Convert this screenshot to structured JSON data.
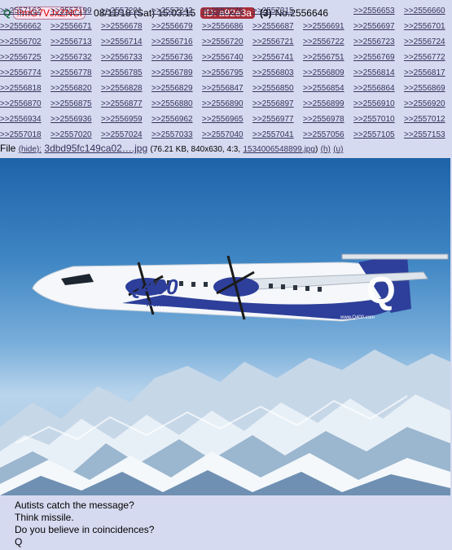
{
  "header": {
    "name": "Q",
    "tripcode": "!!mG7VJxZNCI",
    "datetime": "08/11/18 (Sat) 15:03:15",
    "id": "ID: a92e3a",
    "post_count": "(3)",
    "post_number": "No.2556646"
  },
  "backlinks": [
    ">>2556653",
    ">>2556660",
    ">>2556662",
    ">>2556671",
    ">>2556678",
    ">>2556679",
    ">>2556686",
    ">>2556687",
    ">>2556691",
    ">>2556697",
    ">>2556701",
    ">>2556702",
    ">>2556713",
    ">>2556714",
    ">>2556716",
    ">>2556720",
    ">>2556721",
    ">>2556722",
    ">>2556723",
    ">>2556724",
    ">>2556725",
    ">>2556732",
    ">>2556733",
    ">>2556736",
    ">>2556740",
    ">>2556741",
    ">>2556751",
    ">>2556769",
    ">>2556772",
    ">>2556774",
    ">>2556778",
    ">>2556785",
    ">>2556789",
    ">>2556795",
    ">>2556803",
    ">>2556809",
    ">>2556814",
    ">>2556817",
    ">>2556818",
    ">>2556820",
    ">>2556828",
    ">>2556829",
    ">>2556847",
    ">>2556850",
    ">>2556854",
    ">>2556864",
    ">>2556869",
    ">>2556870",
    ">>2556875",
    ">>2556877",
    ">>2556880",
    ">>2556890",
    ">>2556897",
    ">>2556899",
    ">>2556910",
    ">>2556920",
    ">>2556934",
    ">>2556936",
    ">>2556959",
    ">>2556962",
    ">>2556965",
    ">>2556977",
    ">>2556978",
    ">>2557010",
    ">>2557012",
    ">>2557018",
    ">>2557020",
    ">>2557024",
    ">>2557033",
    ">>2557040",
    ">>2557041",
    ">>2557056",
    ">>2557105",
    ">>2557153",
    ">>2557162",
    ">>2557199",
    ">>2557201",
    ">>2557242",
    ">>2557276",
    ">>2557315"
  ],
  "file": {
    "label": "File",
    "hide": "(hide):",
    "filename": "3dbd95fc149ca02….jpg",
    "details_prefix": "(76.21 KB, 840x630, 4:3,",
    "original_name": "1534006548899.jpg",
    "details_suffix": ")",
    "h_link": "(h)",
    "u_link": "(u)"
  },
  "image": {
    "tail_logo": "Q",
    "fuselage_logo": "Q400",
    "fuselage_sub": "NextGen",
    "tail_url": "www.Q400.com"
  },
  "message": [
    "Autists catch the message?",
    "Think missile.",
    "Do you believe in coincidences?",
    "Q"
  ],
  "colors": {
    "background": "#d6daf0",
    "name": "#117743",
    "link": "#34345c",
    "id_badge": "#a92e3a"
  }
}
